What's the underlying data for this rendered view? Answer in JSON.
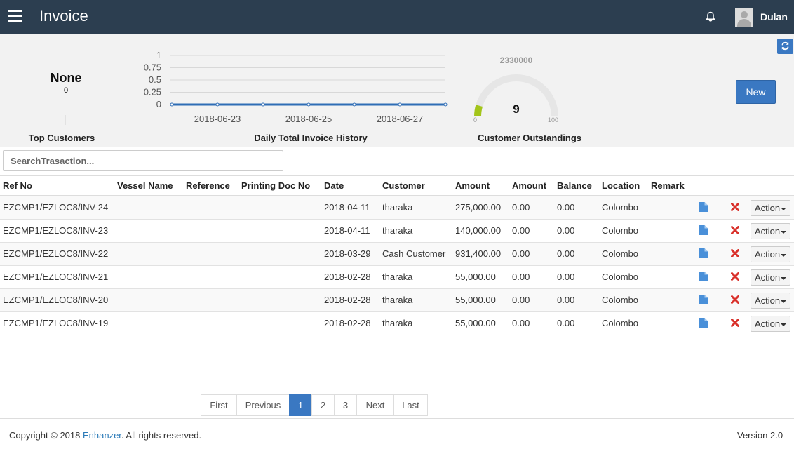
{
  "header": {
    "title": "Invoice",
    "user_name": "Dulan",
    "menu_icon": "hamburger-icon",
    "notification_icon": "bell-icon"
  },
  "dashboard": {
    "top_customers": {
      "value": "None",
      "sub_value": "0",
      "label": "Top Customers"
    },
    "invoice_history": {
      "label": "Daily Total Invoice History"
    },
    "outstandings": {
      "label": "Customer Outstandings",
      "total": "2330000",
      "value": "9",
      "min_label": "0",
      "max_label": "100"
    },
    "new_button": "New"
  },
  "chart_data": [
    {
      "type": "line",
      "yticks": [
        "1",
        "0.75",
        "0.5",
        "0.25",
        "0"
      ],
      "ylim": [
        0,
        1
      ],
      "xtick_labels": [
        "2018-06-23",
        "2018-06-25",
        "2018-06-27"
      ],
      "x": [
        "2018-06-22",
        "2018-06-23",
        "2018-06-24",
        "2018-06-25",
        "2018-06-26",
        "2018-06-27",
        "2018-06-28"
      ],
      "series": [
        {
          "values": [
            0,
            0,
            0,
            0,
            0,
            0,
            0
          ],
          "color": "#2f6db5"
        }
      ],
      "grid": true
    },
    {
      "type": "gauge",
      "value": 9,
      "min": 0,
      "max": 100,
      "fill_color": "#a3c51a"
    }
  ],
  "search": {
    "placeholder": "SearchTrasaction..."
  },
  "table": {
    "columns": [
      "Ref No",
      "Vessel Name",
      "Reference",
      "Printing Doc No",
      "Date",
      "Customer",
      "Amount",
      "Amount",
      "Balance",
      "Location",
      "Remark"
    ],
    "action_label": "Action",
    "rows": [
      {
        "ref": "EZCMP1/EZLOC8/INV-24",
        "vessel": "",
        "reference": "",
        "printing_doc": "",
        "date": "2018-04-11",
        "customer": "tharaka",
        "amount": "275,000.00",
        "amount2": "0.00",
        "balance": "0.00",
        "location": "Colombo",
        "remark": ""
      },
      {
        "ref": "EZCMP1/EZLOC8/INV-23",
        "vessel": "",
        "reference": "",
        "printing_doc": "",
        "date": "2018-04-11",
        "customer": "tharaka",
        "amount": "140,000.00",
        "amount2": "0.00",
        "balance": "0.00",
        "location": "Colombo",
        "remark": ""
      },
      {
        "ref": "EZCMP1/EZLOC8/INV-22",
        "vessel": "",
        "reference": "",
        "printing_doc": "",
        "date": "2018-03-29",
        "customer": "Cash Customer",
        "amount": "931,400.00",
        "amount2": "0.00",
        "balance": "0.00",
        "location": "Colombo",
        "remark": ""
      },
      {
        "ref": "EZCMP1/EZLOC8/INV-21",
        "vessel": "",
        "reference": "",
        "printing_doc": "",
        "date": "2018-02-28",
        "customer": "tharaka",
        "amount": "55,000.00",
        "amount2": "0.00",
        "balance": "0.00",
        "location": "Colombo",
        "remark": ""
      },
      {
        "ref": "EZCMP1/EZLOC8/INV-20",
        "vessel": "",
        "reference": "",
        "printing_doc": "",
        "date": "2018-02-28",
        "customer": "tharaka",
        "amount": "55,000.00",
        "amount2": "0.00",
        "balance": "0.00",
        "location": "Colombo",
        "remark": ""
      },
      {
        "ref": "EZCMP1/EZLOC8/INV-19",
        "vessel": "",
        "reference": "",
        "printing_doc": "",
        "date": "2018-02-28",
        "customer": "tharaka",
        "amount": "55,000.00",
        "amount2": "0.00",
        "balance": "0.00",
        "location": "Colombo",
        "remark": ""
      }
    ]
  },
  "pagination": {
    "items": [
      "First",
      "Previous",
      "1",
      "2",
      "3",
      "Next",
      "Last"
    ],
    "active": "1"
  },
  "footer": {
    "copyright_prefix": "Copyright © 2018 ",
    "brand": "Enhanzer",
    "copyright_suffix": ". All rights reserved.",
    "version": "Version 2.0"
  },
  "colors": {
    "topbar": "#2c3e50",
    "primary": "#3a78c2",
    "delete": "#d9312b",
    "doc_icon": "#4a90d9"
  }
}
